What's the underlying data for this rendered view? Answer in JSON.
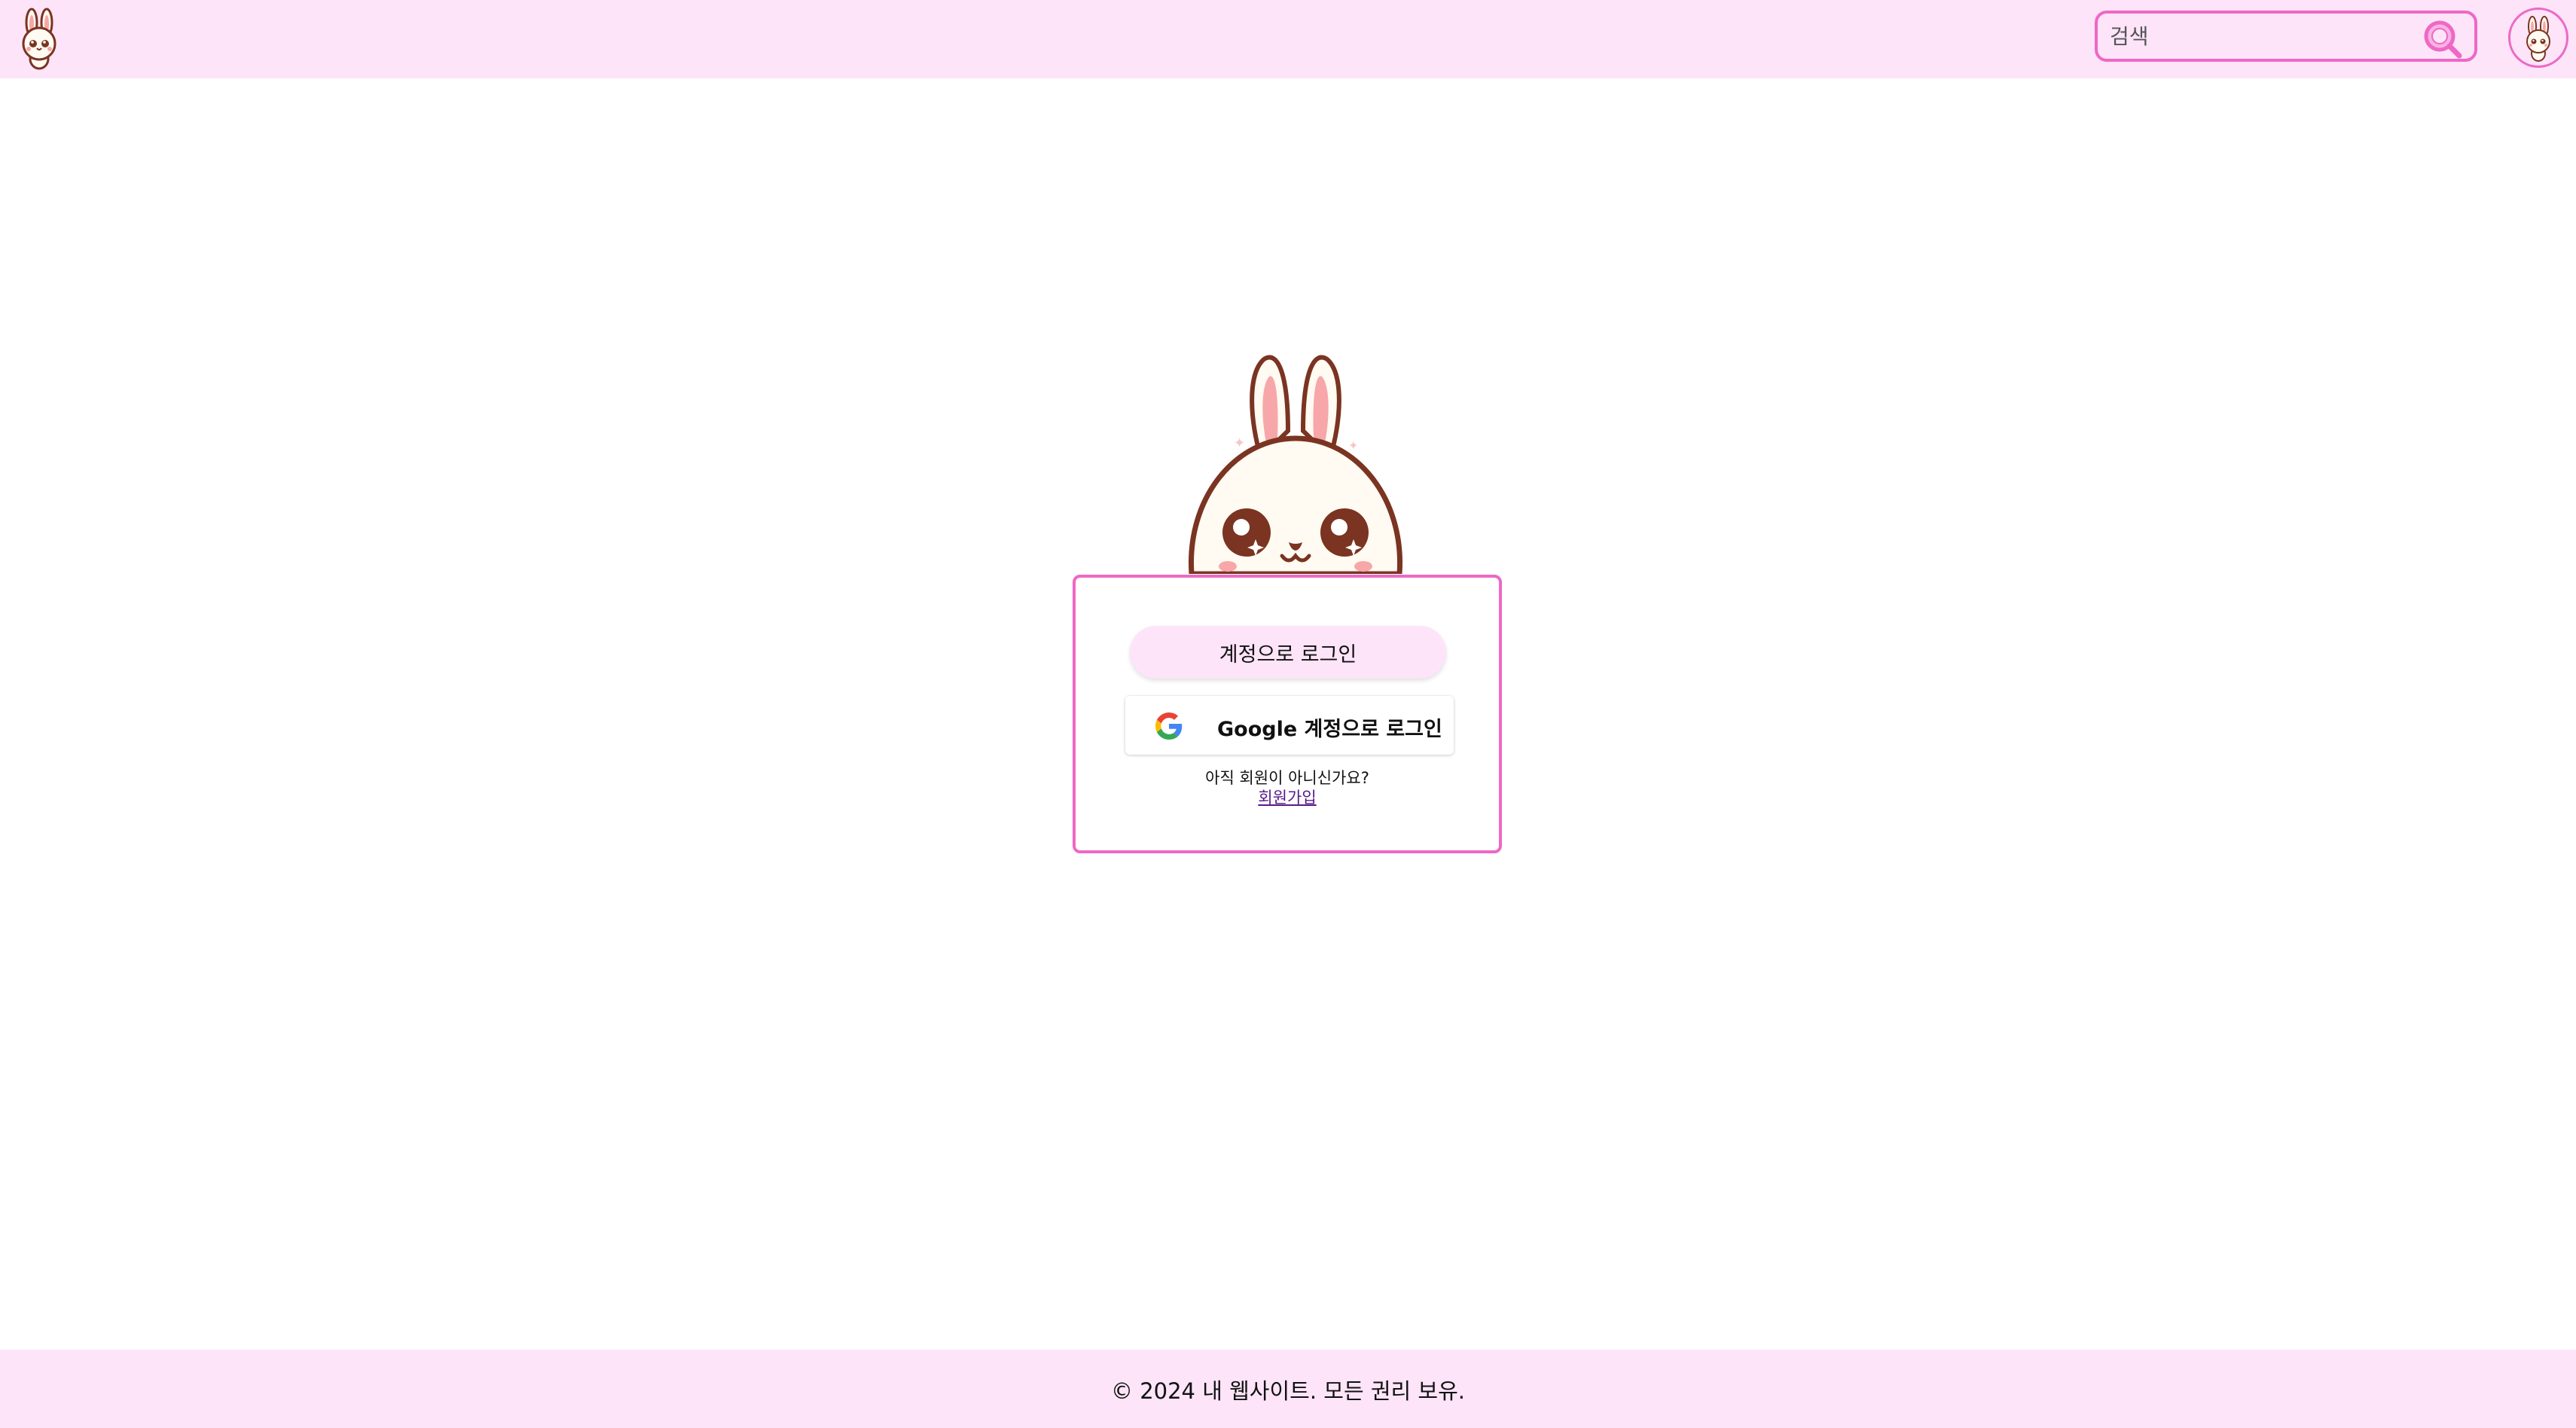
{
  "header": {
    "logo_icon": "bunny-logo-icon",
    "search": {
      "placeholder": "검색",
      "value": "",
      "button_icon": "search-icon"
    },
    "avatar_icon": "bunny-avatar-icon"
  },
  "mascot_icon": "bunny-mascot-icon",
  "login": {
    "account_button_label": "계정으로 로그인",
    "google_button_label": "Google 계정으로 로그인",
    "google_icon": "google-g-icon",
    "signup_question": "아직 회원이 아니신가요?",
    "signup_link_label": "회원가입"
  },
  "footer": {
    "copyright": "© 2024 내 웹사이트. 모든 권리 보유."
  },
  "colors": {
    "header_bg": "#fde4f9",
    "accent_pink": "#ee68c5",
    "bunny_outline": "#7a3421",
    "bunny_inner_ear": "#f7a7a9",
    "bunny_face": "#fffaf2"
  }
}
